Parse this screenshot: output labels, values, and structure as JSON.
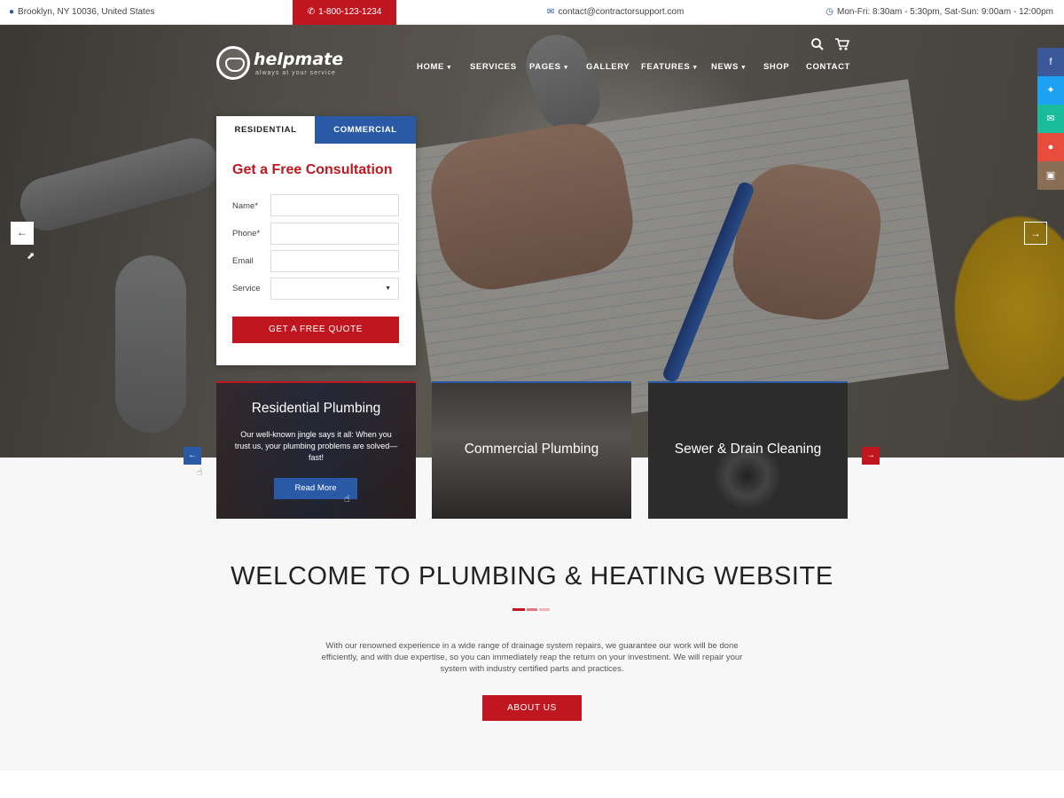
{
  "topbar": {
    "location": "Brooklyn, NY 10036, United States",
    "phone": "1-800-123-1234",
    "email": "contact@contractorsupport.com",
    "hours": "Mon-Fri: 8:30am - 5:30pm, Sat-Sun: 9:00am - 12:00pm"
  },
  "brand": {
    "name": "helpmate",
    "tagline": "always at your service"
  },
  "nav": {
    "home": "HOME",
    "services": "SERVICES",
    "pages": "PAGES",
    "gallery": "GALLERY",
    "features": "FEATURES",
    "news": "NEWS",
    "shop": "SHOP",
    "contact": "CONTACT"
  },
  "form": {
    "tab_residential": "RESIDENTIAL",
    "tab_commercial": "COMMERCIAL",
    "title": "Get a Free Consultation",
    "name_label": "Name*",
    "phone_label": "Phone*",
    "email_label": "Email",
    "service_label": "Service",
    "name_value": "",
    "phone_value": "",
    "email_value": "",
    "service_value": "",
    "submit": "GET A FREE QUOTE"
  },
  "services": [
    {
      "title": "Residential Plumbing",
      "description": "Our well-known jingle says it all: When you trust us, your plumbing problems are solved—fast!",
      "button": "Read More"
    },
    {
      "title": "Commercial Plumbing"
    },
    {
      "title": "Sewer & Drain Cleaning"
    }
  ],
  "welcome": {
    "heading": "WELCOME TO PLUMBING & HEATING WEBSITE",
    "body": "With our renowned experience in a wide range of drainage system repairs, we guarantee our work will be done efficiently, and with due expertise, so you can immediately reap the return on your investment. We will repair your system with industry certified parts and practices.",
    "button": "ABOUT US"
  },
  "social": [
    "facebook-icon",
    "twitter-icon",
    "email-icon",
    "location-icon",
    "instagram-icon"
  ],
  "colors": {
    "accent_red": "#c0161f",
    "accent_blue": "#2a5aa6",
    "facebook": "#3b5998",
    "twitter": "#1da1f2",
    "email": "#1abc9c",
    "location": "#e74c3c",
    "instagram": "#8a6d55"
  }
}
